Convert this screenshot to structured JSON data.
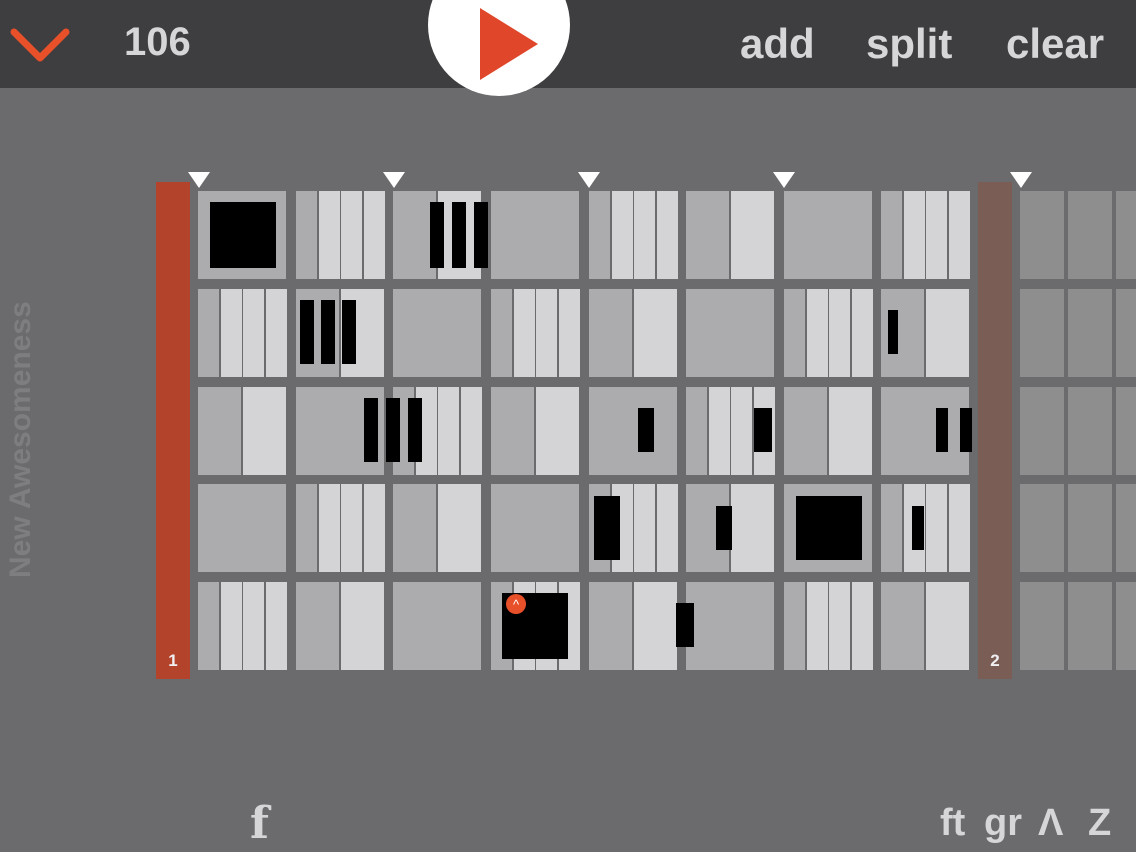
{
  "toolbar": {
    "tempo": "106",
    "add_label": "add",
    "split_label": "split",
    "clear_label": "clear"
  },
  "sidebar": {
    "sequence_name": "New Awesomeness"
  },
  "bars": [
    {
      "number": "1"
    },
    {
      "number": "2"
    }
  ],
  "bottom": {
    "left_label": "f",
    "icons": [
      "ft",
      "gr",
      "Λ",
      "Z"
    ]
  },
  "colors": {
    "accent": "#e8502a",
    "bar1": "#b3432a",
    "bar2": "#7a5e56",
    "cell_light": "#d4d3d6",
    "cell_mid": "#acabad",
    "rest": "#000000"
  }
}
